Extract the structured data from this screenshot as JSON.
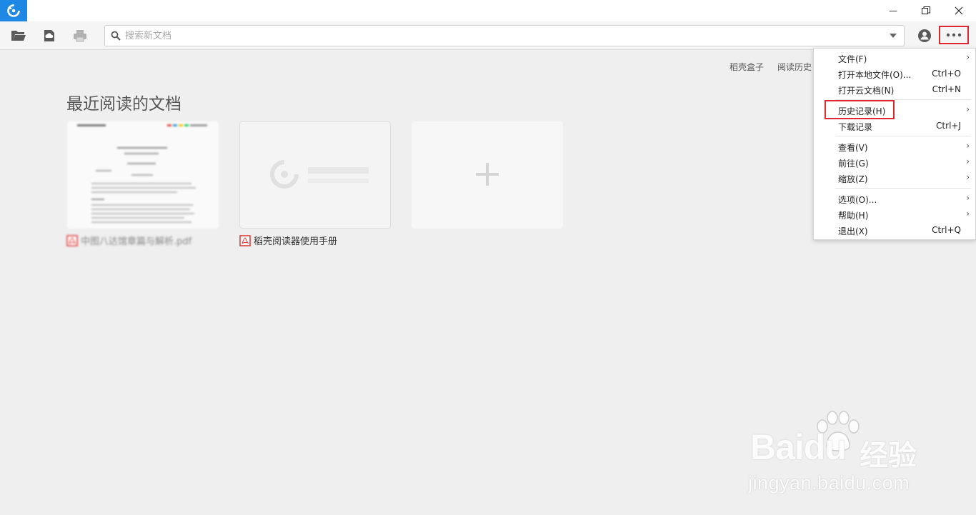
{
  "titlebar": {
    "logo_icon": "foxit-reader-logo-icon",
    "minimize_glyph": "—",
    "restore_glyph": "❐",
    "close_glyph": "✕",
    "accent": "#1e88e5"
  },
  "toolbar": {
    "icons": [
      "folder-open-icon",
      "cloud-upload-icon",
      "printer-icon"
    ],
    "search_placeholder": "搜索新文档",
    "user_icon": "user-account-icon",
    "more_icon": "more-options-icon"
  },
  "top_links": {
    "box": "稻壳盒子",
    "history": "阅读历史"
  },
  "recent": {
    "title": "最近阅读的文档",
    "docs": [
      {
        "name": "中图八达馆章篇与解析.pdf",
        "blurred": true
      },
      {
        "name": "稻壳阅读器使用手册",
        "blurred": false
      }
    ],
    "add_glyph": "+"
  },
  "menu": {
    "items": [
      {
        "label": "文件(F)",
        "shortcut": "",
        "submenu": true
      },
      {
        "label": "打开本地文件(O)...",
        "shortcut": "Ctrl+O",
        "submenu": false
      },
      {
        "label": "打开云文档(N)",
        "shortcut": "Ctrl+N",
        "submenu": false
      },
      {
        "label": "历史记录(H)",
        "shortcut": "",
        "submenu": true
      },
      {
        "label": "下载记录",
        "shortcut": "Ctrl+J",
        "submenu": false
      },
      {
        "label": "查看(V)",
        "shortcut": "",
        "submenu": true
      },
      {
        "label": "前往(G)",
        "shortcut": "",
        "submenu": true
      },
      {
        "label": "缩放(Z)",
        "shortcut": "",
        "submenu": true
      },
      {
        "label": "选项(O)...",
        "shortcut": "",
        "submenu": true
      },
      {
        "label": "帮助(H)",
        "shortcut": "",
        "submenu": true
      },
      {
        "label": "退出(X)",
        "shortcut": "Ctrl+Q",
        "submenu": false
      }
    ],
    "arrow_glyph": "›",
    "highlight_color": "#e0282e"
  },
  "watermark": {
    "brand": "Baidu",
    "cn": "经验",
    "url": "jingyan.baidu.com"
  }
}
